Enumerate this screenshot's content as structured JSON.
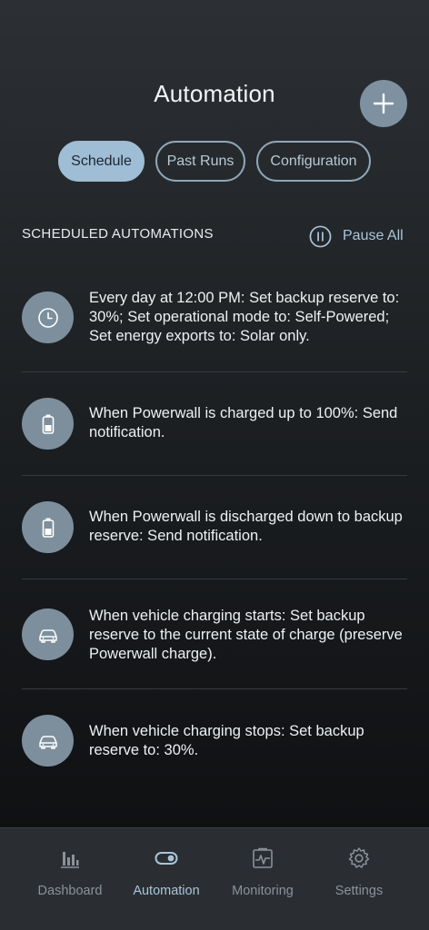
{
  "header": {
    "title": "Automation",
    "add_icon": "plus-icon"
  },
  "tabs": [
    {
      "label": "Schedule",
      "active": true
    },
    {
      "label": "Past Runs",
      "active": false
    },
    {
      "label": "Configuration",
      "active": false
    }
  ],
  "section": {
    "title": "SCHEDULED AUTOMATIONS",
    "pause_all_label": "Pause All",
    "pause_icon": "pause-circle-icon"
  },
  "automations": [
    {
      "icon": "clock-icon",
      "text": "Every day at 12:00 PM: Set backup reserve to: 30%; Set operational mode to: Self-Powered; Set energy exports to: Solar only."
    },
    {
      "icon": "battery-icon",
      "text": "When Powerwall is charged up to 100%: Send notification."
    },
    {
      "icon": "battery-icon",
      "text": "When Powerwall is discharged down to backup reserve: Send notification."
    },
    {
      "icon": "car-icon",
      "text": "When vehicle charging starts: Set backup reserve to the current state of charge (preserve Powerwall charge)."
    },
    {
      "icon": "car-icon",
      "text": "When vehicle charging stops: Set backup reserve to: 30%."
    }
  ],
  "bottom_nav": [
    {
      "label": "Dashboard",
      "icon": "bar-chart-icon",
      "active": false
    },
    {
      "label": "Automation",
      "icon": "toggle-icon",
      "active": true
    },
    {
      "label": "Monitoring",
      "icon": "monitor-pulse-icon",
      "active": false
    },
    {
      "label": "Settings",
      "icon": "gear-icon",
      "active": false
    }
  ],
  "colors": {
    "accent": "#a9c5da",
    "active_tab_bg": "#9fbdd4",
    "icon_circle": "#7d8f9d",
    "add_button": "#7e91a1"
  }
}
